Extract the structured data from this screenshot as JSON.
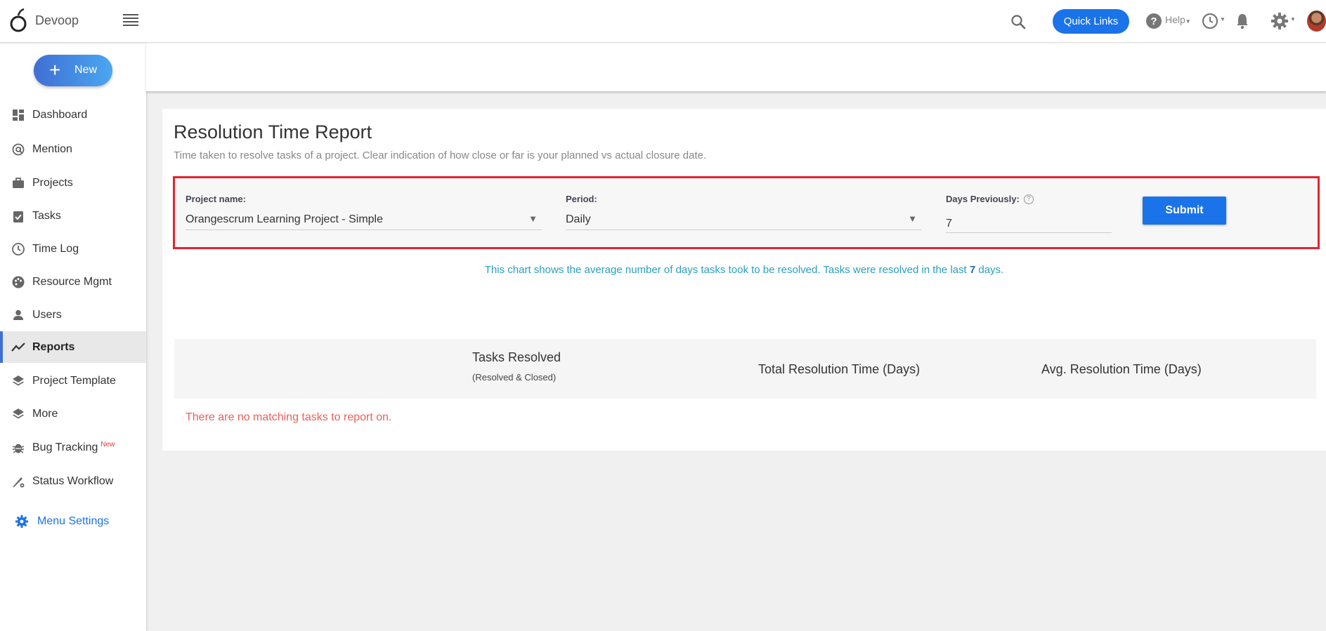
{
  "app": {
    "brand": "Devoop",
    "quick_links": "Quick Links",
    "help_label": "Help"
  },
  "sidebar": {
    "new_label": "New",
    "items": [
      {
        "label": "Dashboard",
        "icon": "dashboard-icon"
      },
      {
        "label": "Mention",
        "icon": "at-icon"
      },
      {
        "label": "Projects",
        "icon": "briefcase-icon"
      },
      {
        "label": "Tasks",
        "icon": "clipboard-check-icon"
      },
      {
        "label": "Time Log",
        "icon": "clock-icon"
      },
      {
        "label": "Resource Mgmt",
        "icon": "palette-icon"
      },
      {
        "label": "Users",
        "icon": "person-icon"
      },
      {
        "label": "Reports",
        "icon": "trend-line-icon",
        "active": true
      },
      {
        "label": "Project Template",
        "icon": "layers-icon"
      },
      {
        "label": "More",
        "icon": "layers-icon"
      },
      {
        "label": "Bug Tracking",
        "icon": "bug-icon",
        "badge": "New"
      },
      {
        "label": "Status Workflow",
        "icon": "workflow-icon"
      }
    ],
    "menu_settings": "Menu Settings"
  },
  "report": {
    "title": "Resolution Time Report",
    "subtitle": "Time taken to resolve tasks of a project. Clear indication of how close or far is your planned vs actual closure date.",
    "filters": {
      "project_label": "Project name:",
      "project_value": "Orangescrum Learning Project - Simple",
      "period_label": "Period:",
      "period_value": "Daily",
      "days_label": "Days Previously:",
      "days_value": "7",
      "help_mark": "?",
      "submit": "Submit"
    },
    "note_before": "This chart shows the average number of days tasks took to be resolved. Tasks were resolved in the last",
    "note_days": "7",
    "note_after": "days.",
    "table": {
      "col1": "Tasks Resolved",
      "col1_sub": "(Resolved & Closed)",
      "col2": "Total Resolution Time (Days)",
      "col3": "Avg. Resolution Time (Days)"
    },
    "empty_message": "There are no matching tasks to report on."
  },
  "colors": {
    "accent": "#1a73e8",
    "highlight_border": "#e0252f",
    "empty_text": "#e8605a",
    "note_text": "#2a9ec0"
  }
}
